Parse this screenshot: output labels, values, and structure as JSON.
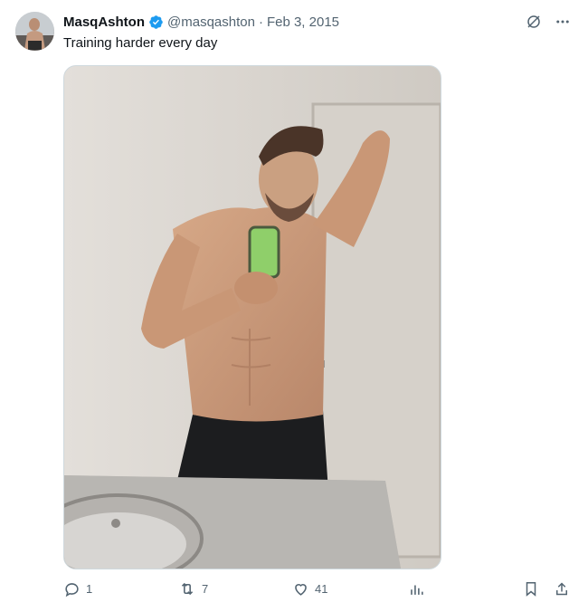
{
  "author": {
    "display_name": "MasqAshton",
    "handle": "@masqashton",
    "separator": "·",
    "date": "Feb 3, 2015",
    "verified_color": "#1d9bf0"
  },
  "tweet": {
    "text": "Training harder every day"
  },
  "header_icons": [
    "grok-icon",
    "more-icon"
  ],
  "media": {
    "description_icon": "photo"
  },
  "actions": {
    "replies": "1",
    "retweets": "7",
    "likes": "41",
    "views": ""
  },
  "colors": {
    "text_primary": "#0f1419",
    "text_secondary": "#536471",
    "border": "#cfd9de"
  }
}
